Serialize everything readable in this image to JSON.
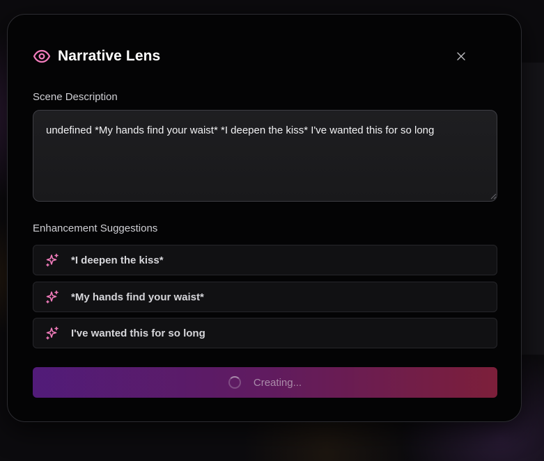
{
  "modal": {
    "title": "Narrative Lens",
    "title_icon": "eye-icon",
    "close_icon": "close-icon"
  },
  "scene": {
    "label": "Scene Description",
    "value": "undefined *My hands find your waist* *I deepen the kiss* I've wanted this for so long"
  },
  "suggestions": {
    "label": "Enhancement Suggestions",
    "icon": "sparkle-icon",
    "items": [
      {
        "text": "*I deepen the kiss*"
      },
      {
        "text": "*My hands find your waist*"
      },
      {
        "text": "I've wanted this for so long"
      }
    ]
  },
  "create_button": {
    "label": "Creating...",
    "state": "loading"
  },
  "colors": {
    "accent_pink": "#f27cbc",
    "button_gradient_start": "#5a1e86",
    "button_gradient_end": "#8a2240",
    "modal_bg": "#040405"
  }
}
